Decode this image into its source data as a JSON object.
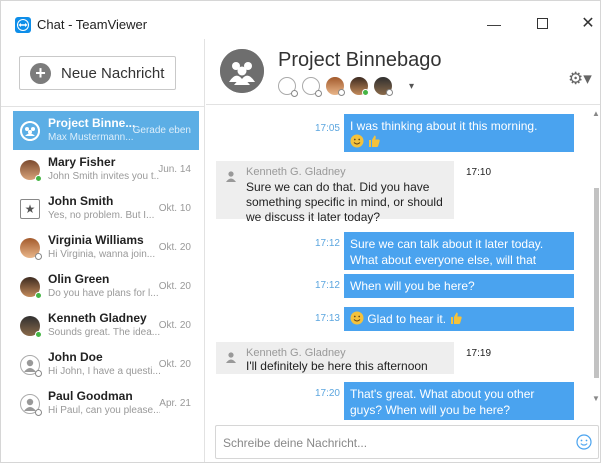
{
  "window": {
    "title": "Chat - TeamViewer",
    "minimize": "—",
    "close": "✕"
  },
  "sidebar": {
    "new_message_label": "Neue Nachricht",
    "conversations": [
      {
        "name": "Project Binne...",
        "preview": "Max Mustermann...",
        "date": "Gerade eben",
        "active": true
      },
      {
        "name": "Mary Fisher",
        "preview": "John Smith invites you t...",
        "date": "Jun. 14"
      },
      {
        "name": "John Smith",
        "preview": "Yes, no problem. But I...",
        "date": "Okt. 10"
      },
      {
        "name": "Virginia Williams",
        "preview": "Hi Virginia, wanna join...",
        "date": "Okt. 20"
      },
      {
        "name": "Olin Green",
        "preview": "Do you have plans for l...",
        "date": "Okt. 20"
      },
      {
        "name": "Kenneth Gladney",
        "preview": "Sounds great. The idea...",
        "date": "Okt. 20"
      },
      {
        "name": "John Doe",
        "preview": "Hi John, I have a questi...",
        "date": "Okt. 20"
      },
      {
        "name": "Paul Goodman",
        "preview": "Hi Paul, can you please...",
        "date": "Apr. 21"
      }
    ]
  },
  "header": {
    "title": "Project Binnebago",
    "caret": "▾",
    "gear": "⚙▾"
  },
  "messages": [
    {
      "type": "out",
      "time": "17:05",
      "text": "I was thinking about it this morning."
    },
    {
      "type": "in",
      "sender": "Kenneth G. Gladney",
      "text": "Sure we can do that. Did you have something specific in mind, or should we discuss it later today?",
      "time": "17:10"
    },
    {
      "type": "out",
      "time": "17:12",
      "text": "Sure we can talk about it later today. What about everyone else, will that work?"
    },
    {
      "type": "out",
      "time": "17:12",
      "text": "When will you be here?"
    },
    {
      "type": "out",
      "time": "17:13",
      "text": "Glad to hear it."
    },
    {
      "type": "in",
      "sender": "Kenneth G. Gladney",
      "text": "I'll definitely be here this afternoon",
      "time": "17:19"
    },
    {
      "type": "out",
      "time": "17:20",
      "text": "That's great. What about you other guys? When will you be here?"
    }
  ],
  "composer": {
    "placeholder": "Schreibe deine Nachricht..."
  },
  "colors": {
    "accent": "#4aa3ef",
    "active_row": "#5caee5",
    "online": "#45b545"
  }
}
